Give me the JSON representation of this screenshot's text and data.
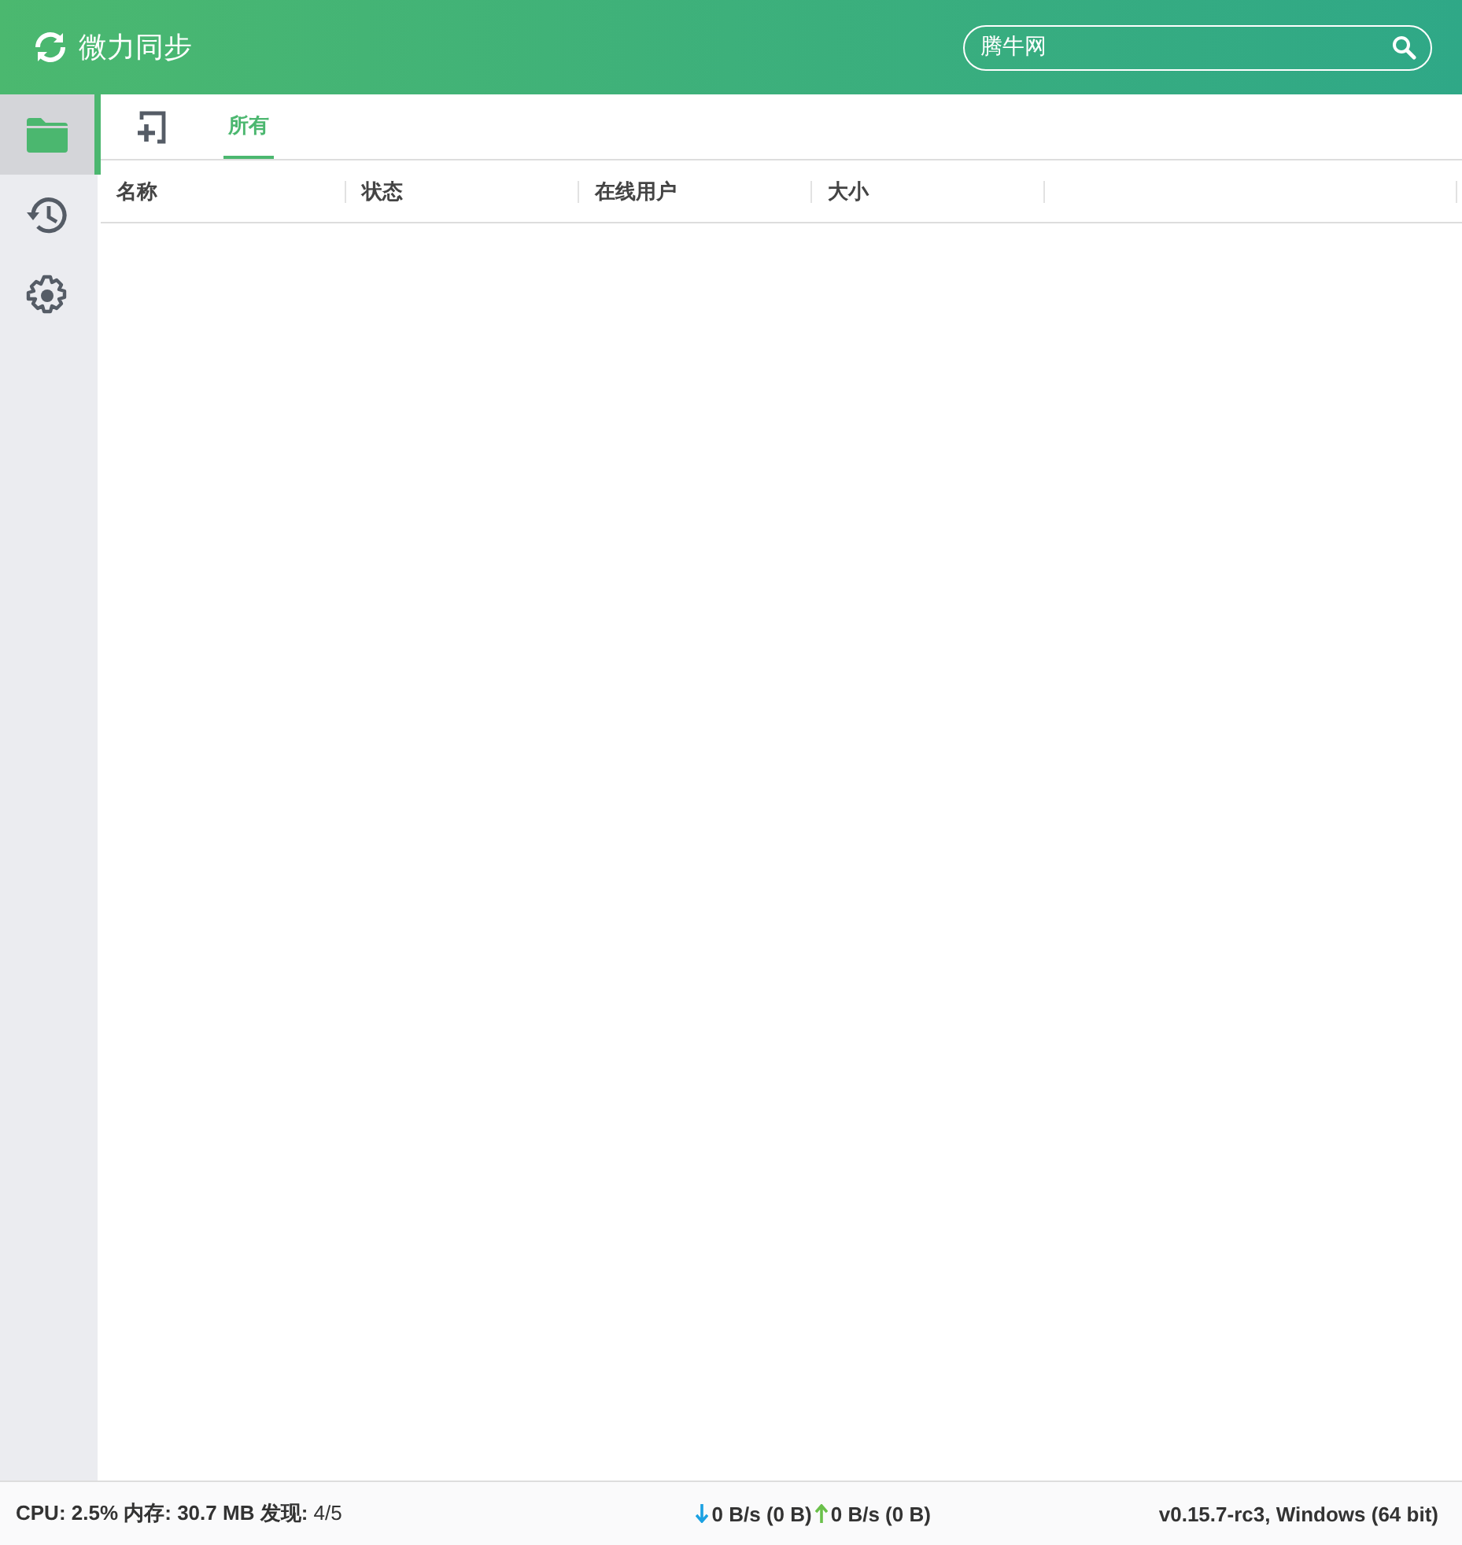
{
  "app": {
    "title": "微力同步"
  },
  "search": {
    "value": "腾牛网"
  },
  "sidebar": {
    "items": [
      {
        "kind": "folder",
        "selected": true
      },
      {
        "kind": "history",
        "selected": false
      },
      {
        "kind": "settings",
        "selected": false
      }
    ]
  },
  "tabs": [
    {
      "label": "所有",
      "selected": true
    }
  ],
  "table": {
    "columns": [
      "名称",
      "状态",
      "在线用户",
      "大小"
    ]
  },
  "status_bar": {
    "stats": "**CPU: 2.5% 内存: 30.7 MB 发现:** 4/5",
    "download": "0 B/s (0 B)",
    "upload": "0 B/s (0 B)",
    "version": "v0.15.7-rc3, Windows (64 bit)"
  }
}
